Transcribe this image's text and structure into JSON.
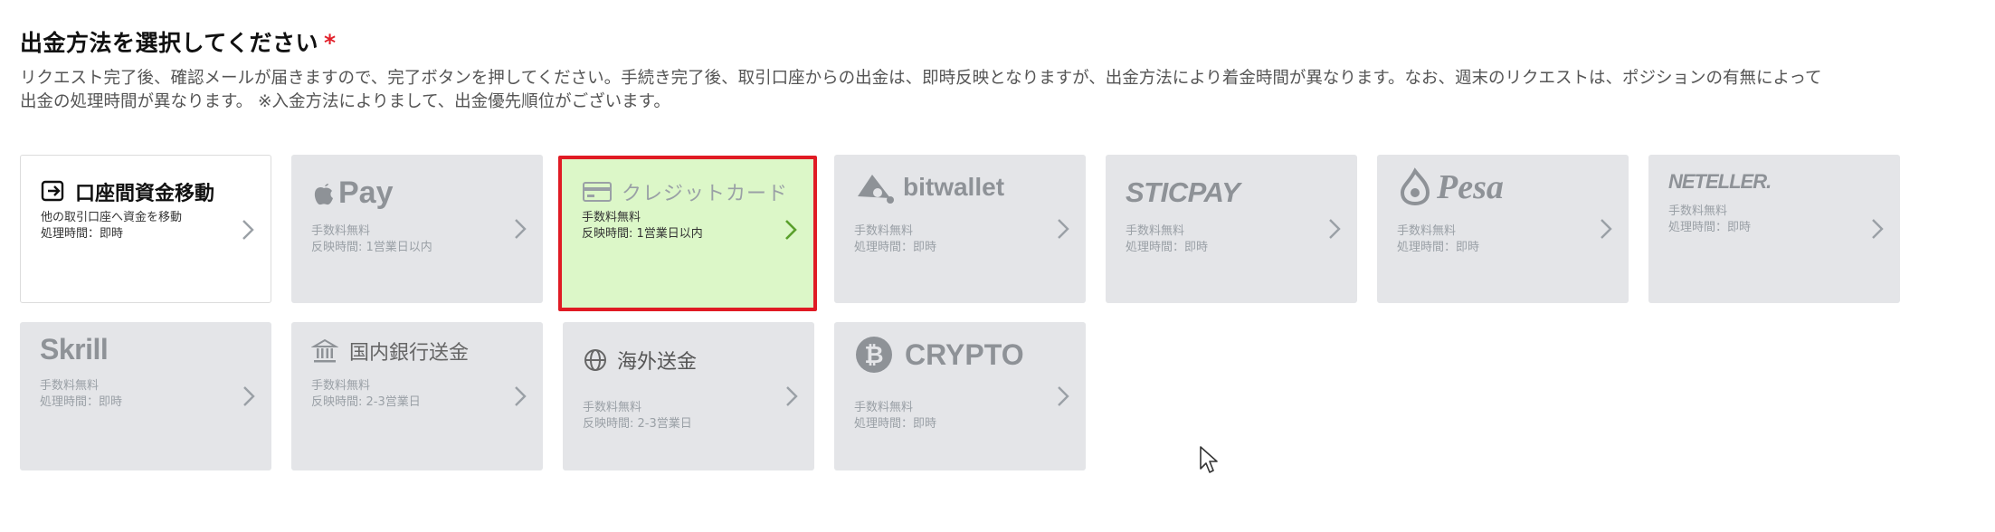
{
  "heading": {
    "title": "出金方法を選択してください",
    "required_mark": "*"
  },
  "description": {
    "line1": "リクエスト完了後、確認メールが届きますので、完了ボタンを押してください。手続き完了後、取引口座からの出金は、即時反映となりますが、出金方法により着金時間が異なります。なお、週末のリクエストは、ポジションの有無によって",
    "line2": "出金の処理時間が異なります。 ※入金方法によりまして、出金優先順位がございます。"
  },
  "methods": [
    {
      "label": "口座間資金移動",
      "icon": "transfer-icon",
      "line1": "他の取引口座へ資金を移動",
      "line2": "処理時間：即時"
    },
    {
      "label": "Pay",
      "icon": "apple-icon",
      "line1": "手数料無料",
      "line2": "反映時間: 1営業日以内"
    },
    {
      "label": "クレジットカード",
      "icon": "credit-card-icon",
      "line1": "手数料無料",
      "line2": "反映時間: 1営業日以内"
    },
    {
      "label": "bitwallet",
      "icon": "bitwallet-icon",
      "line1": "手数料無料",
      "line2": "処理時間：即時"
    },
    {
      "label": "STICPAY",
      "icon": "sticpay-logo",
      "line1": "手数料無料",
      "line2": "処理時間：即時"
    },
    {
      "label": "Pesa",
      "icon": "pesa-icon",
      "line1": "手数料無料",
      "line2": "処理時間：即時"
    },
    {
      "label": "NETELLER.",
      "icon": "neteller-logo",
      "line1": "手数料無料",
      "line2": "処理時間：即時"
    },
    {
      "label": "Skrill",
      "icon": "skrill-logo",
      "line1": "手数料無料",
      "line2": "処理時間：即時"
    },
    {
      "label": "国内銀行送金",
      "icon": "bank-icon",
      "line1": "手数料無料",
      "line2": "反映時間: 2-3営業日"
    },
    {
      "label": "海外送金",
      "icon": "globe-icon",
      "line1": "手数料無料",
      "line2": "反映時間: 2-3営業日"
    },
    {
      "label": "CRYPTO",
      "icon": "bitcoin-icon",
      "line1": "手数料無料",
      "line2": "処理時間：即時"
    }
  ],
  "selected_method": "クレジットカード",
  "colors": {
    "selected_bg": "#dcf7c8",
    "selected_border": "#e01b24",
    "card_bg": "#e4e5e8",
    "required": "#e2202a",
    "chevron_selected": "#5aa02c"
  }
}
